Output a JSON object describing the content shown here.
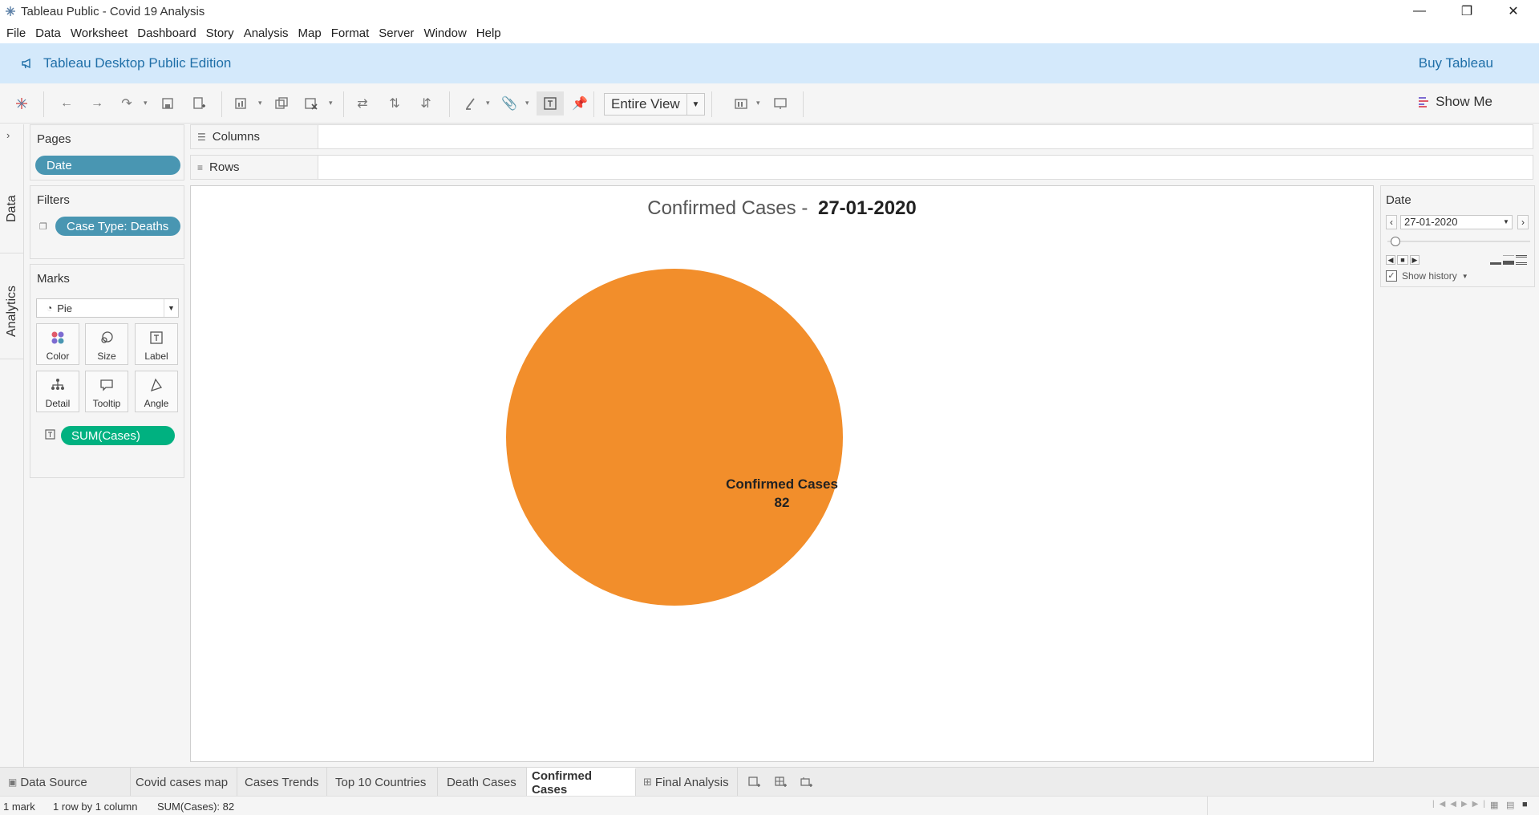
{
  "window": {
    "title": "Tableau Public - Covid 19 Analysis",
    "controls": [
      "minimize-icon",
      "restore-icon",
      "close-icon"
    ]
  },
  "menu": [
    "File",
    "Data",
    "Worksheet",
    "Dashboard",
    "Story",
    "Analysis",
    "Map",
    "Format",
    "Server",
    "Window",
    "Help"
  ],
  "banner": {
    "title": "Tableau Desktop Public Edition",
    "buy_label": "Buy Tableau"
  },
  "toolbar": {
    "fit_value": "Entire View",
    "show_me_label": "Show Me"
  },
  "sidetabs": {
    "data": "Data",
    "analytics": "Analytics"
  },
  "pages": {
    "title": "Pages",
    "pill": "Date"
  },
  "filters": {
    "title": "Filters",
    "pill": "Case Type: Deaths"
  },
  "marks": {
    "title": "Marks",
    "mark_type": "Pie",
    "buttons": [
      "Color",
      "Size",
      "Label",
      "Detail",
      "Tooltip",
      "Angle"
    ],
    "field_pill": "SUM(Cases)"
  },
  "shelves": {
    "columns": "Columns",
    "rows": "Rows"
  },
  "viz": {
    "title_prefix": "Confirmed Cases - ",
    "title_date": "27-01-2020",
    "pie_label": "Confirmed Cases",
    "pie_value": "82",
    "pie_color": "#f28e2b"
  },
  "chart_data": {
    "type": "pie",
    "categories": [
      "Confirmed Cases"
    ],
    "values": [
      82
    ],
    "title": "Confirmed Cases - 27-01-2020"
  },
  "page_control": {
    "title": "Date",
    "current": "27-01-2020",
    "show_history_label": "Show history",
    "show_history_checked": true
  },
  "tabs": {
    "data_source": "Data Source",
    "sheets": [
      "Covid cases map",
      "Cases Trends",
      "Top 10 Countries",
      "Death Cases",
      "Confirmed Cases",
      "Final Analysis"
    ],
    "active": "Confirmed Cases"
  },
  "status": {
    "marks": "1 mark",
    "dims": "1 row by 1 column",
    "sum": "SUM(Cases): 82"
  }
}
